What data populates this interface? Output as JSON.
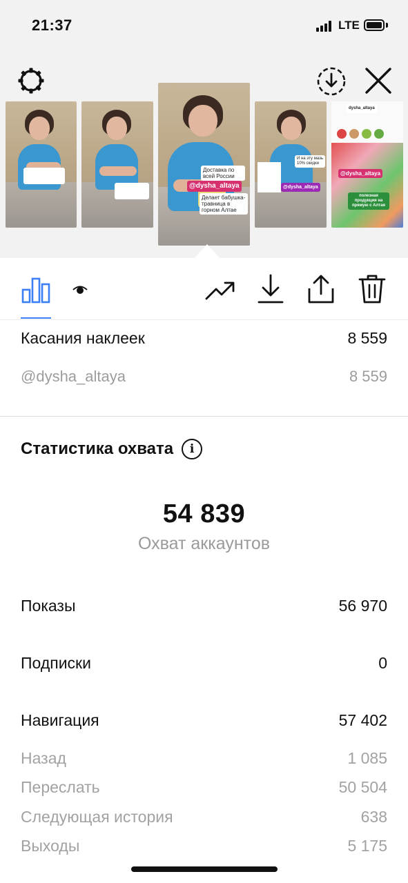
{
  "status_bar": {
    "time": "21:37",
    "network": "LTE"
  },
  "top_bar": {
    "settings_icon": "gear-icon",
    "download_all_icon": "download-circle-icon",
    "close_icon": "close-icon"
  },
  "stories": [
    {
      "stickers": []
    },
    {
      "stickers": []
    },
    {
      "stickers": [
        "Доставка по всей России",
        "@dysha_altaya",
        "Делает бабушка-травница в горном Алтае"
      ],
      "selected": true
    },
    {
      "stickers": [
        "И на эту мазь 10% скидки",
        "@dysha_altaya"
      ]
    },
    {
      "stickers": [
        "dysha_altaya",
        "@dysha_altaya",
        "полезная продукция на прямую с Алтая"
      ]
    }
  ],
  "tabs": {
    "insights_icon": "bar-chart-icon",
    "viewers_icon": "eye-icon",
    "promote_icon": "trending-up-icon",
    "download_icon": "download-icon",
    "share_icon": "share-icon",
    "delete_icon": "trash-icon"
  },
  "sticker_taps": {
    "label": "Касания наклеек",
    "value": "8 559",
    "sub": {
      "label": "@dysha_altaya",
      "value": "8 559"
    }
  },
  "reach": {
    "title": "Статистика охвата",
    "number": "54 839",
    "label": "Охват аккаунтов",
    "rows": [
      {
        "label": "Показы",
        "value": "56 970"
      },
      {
        "label": "Подписки",
        "value": "0"
      },
      {
        "label": "Навигация",
        "value": "57 402"
      }
    ],
    "navigation_details": [
      {
        "label": "Назад",
        "value": "1 085"
      },
      {
        "label": "Переслать",
        "value": "50 504"
      },
      {
        "label": "Следующая история",
        "value": "638"
      },
      {
        "label": "Выходы",
        "value": "5 175"
      }
    ]
  },
  "colors": {
    "accent": "#3a7ff6",
    "muted_text": "#9c9c9c",
    "sticker_pink": "#d6306f"
  }
}
